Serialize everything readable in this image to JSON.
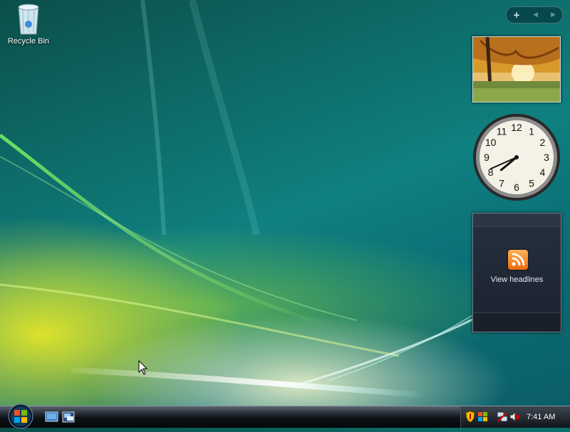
{
  "desktop": {
    "recycle_bin": {
      "label": "Recycle Bin",
      "icon": "recycle-bin-icon"
    }
  },
  "sidebar": {
    "controls": {
      "add": "+",
      "prev": "◀",
      "next": "▶"
    },
    "slideshow": {
      "icon": "autumn-landscape-photo"
    },
    "clock": {
      "numerals": [
        "12",
        "1",
        "2",
        "3",
        "4",
        "5",
        "6",
        "7",
        "8",
        "9",
        "10",
        "11"
      ],
      "time_hour": 7,
      "time_minute": 41
    },
    "feed": {
      "label": "View headlines",
      "icon": "rss-icon"
    }
  },
  "taskbar": {
    "start": "start-orb-icon",
    "quick_launch": [
      "show-desktop-icon",
      "switch-windows-icon"
    ],
    "tray_icons": [
      "security-shield-icon",
      "windows-update-icon",
      "network-icon",
      "volume-muted-icon"
    ],
    "clock": "7:41 AM"
  },
  "colors": {
    "accent": "#0f8080",
    "taskbar": "#0e1216",
    "feed_bg": "#1b2230"
  }
}
